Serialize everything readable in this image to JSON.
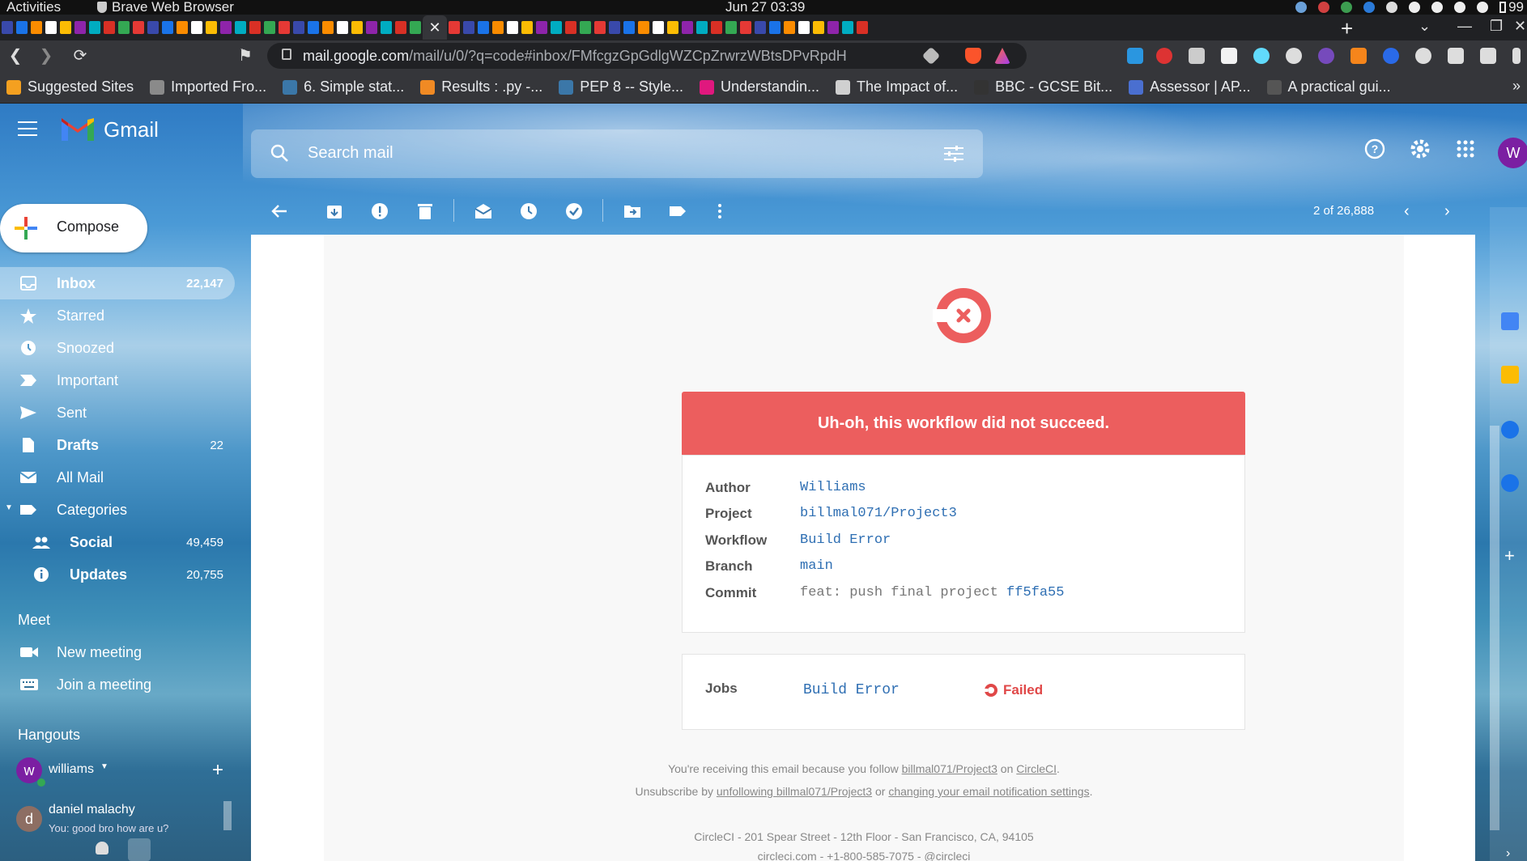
{
  "os": {
    "activities": "Activities",
    "app_name": "Brave Web Browser",
    "clock": "Jun 27  03:39",
    "battery": "99"
  },
  "browser": {
    "url_host": "mail.google.com",
    "url_path": "/mail/u/0/?q=code#inbox/FMfcgzGpGdlgWZCpZrwrzWBtsDPvRpdH"
  },
  "bookmarks": [
    {
      "label": "Suggested Sites",
      "color": "#f4a020"
    },
    {
      "label": "Imported Fro...",
      "color": "#8a8a8a"
    },
    {
      "label": "6. Simple stat...",
      "color": "#3b77a8"
    },
    {
      "label": "Results : .py -...",
      "color": "#f08a24"
    },
    {
      "label": "PEP 8 -- Style...",
      "color": "#3b77a8"
    },
    {
      "label": "Understandin...",
      "color": "#e0187e"
    },
    {
      "label": "The Impact of...",
      "color": "#d0d0d0"
    },
    {
      "label": "BBC - GCSE Bit...",
      "color": "#333333"
    },
    {
      "label": "Assessor | AP...",
      "color": "#4a6fd0"
    },
    {
      "label": "A practical gui...",
      "color": "#555555"
    }
  ],
  "gmail": {
    "brand": "Gmail",
    "search_placeholder": "Search mail",
    "avatar_letter": "W",
    "compose": "Compose",
    "nav": [
      {
        "label": "Inbox",
        "count": "22,147",
        "icon": "inbox-icon"
      },
      {
        "label": "Starred",
        "count": "",
        "icon": "star-icon"
      },
      {
        "label": "Snoozed",
        "count": "",
        "icon": "clock-icon"
      },
      {
        "label": "Important",
        "count": "",
        "icon": "important-icon"
      },
      {
        "label": "Sent",
        "count": "",
        "icon": "send-icon"
      },
      {
        "label": "Drafts",
        "count": "22",
        "icon": "draft-icon"
      },
      {
        "label": "All Mail",
        "count": "",
        "icon": "mail-icon"
      },
      {
        "label": "Categories",
        "count": "",
        "icon": "label-icon"
      },
      {
        "label": "Social",
        "count": "49,459",
        "icon": "people-icon"
      },
      {
        "label": "Updates",
        "count": "20,755",
        "icon": "info-icon"
      }
    ],
    "meet_title": "Meet",
    "new_meeting": "New meeting",
    "join_meeting": "Join a meeting",
    "hangouts_title": "Hangouts",
    "hangout_user": "williams",
    "hangout_user_letter": "w",
    "chat_name": "daniel malachy",
    "chat_letter": "d",
    "chat_preview": "You: good bro how are u?",
    "pager": "2 of 26,888"
  },
  "email": {
    "banner": "Uh-oh, this workflow did not succeed.",
    "details": {
      "author_label": "Author",
      "author": "Williams",
      "project_label": "Project",
      "project": "billmal071/Project3",
      "workflow_label": "Workflow",
      "workflow": "Build Error",
      "branch_label": "Branch",
      "branch": "main",
      "commit_label": "Commit",
      "commit_msg": "feat: push final project ",
      "commit_hash": "ff5fa55"
    },
    "jobs_label": "Jobs",
    "job_name": "Build Error",
    "job_status": "Failed",
    "footer": {
      "line1_a": "You're receiving this email because you follow ",
      "line1_link": "billmal071/Project3",
      "line1_b": " on ",
      "line1_link2": "CircleCI",
      "line1_c": ".",
      "line2_a": "Unsubscribe by ",
      "line2_link": "unfollowing billmal071/Project3",
      "line2_b": " or ",
      "line2_link2": "changing your email notification settings",
      "line2_c": ".",
      "address": "CircleCI - 201 Spear Street - 12th Floor - San Francisco, CA, 94105",
      "site": "circleci.com",
      "phone": " - +1-800-585-7075 - ",
      "twitter": "@circleci"
    }
  },
  "colors": {
    "banner_red": "#ec5e5e",
    "link_blue": "#2f6fb3",
    "failed_red": "#e04848"
  }
}
